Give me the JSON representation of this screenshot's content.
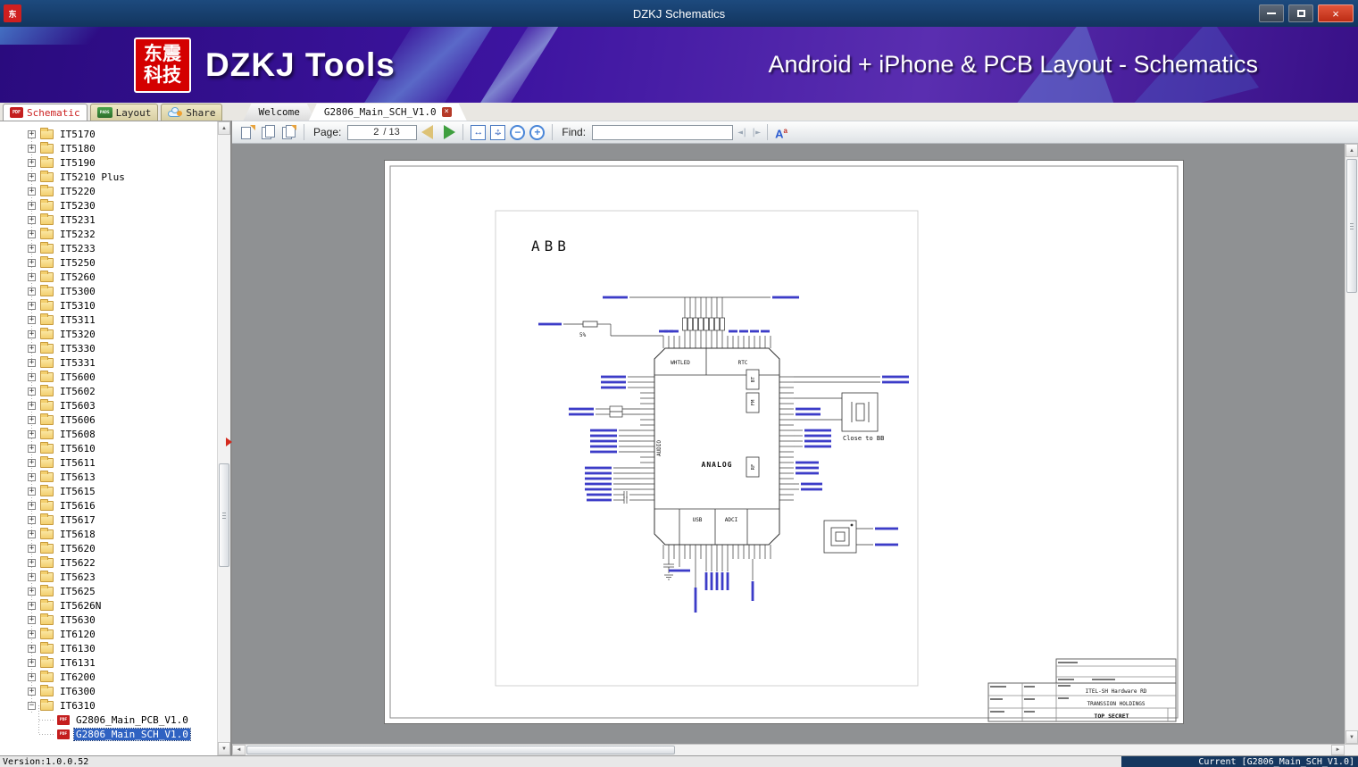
{
  "window": {
    "title": "DZKJ Schematics"
  },
  "icons": {
    "app_icon": "东",
    "pdf_badge": "PDF",
    "pads_badge": "PADS",
    "close_glyph": "×",
    "up_arrow": "▲",
    "down_arrow": "▼",
    "left_arrow": "◄",
    "right_arrow": "►",
    "find_prev": "◄|",
    "find_next": "|►",
    "fit_width": "↔",
    "fit_height": "↕",
    "zoom_out": "−",
    "zoom_in": "+",
    "font_big": "A",
    "font_small": "a",
    "expand": "+",
    "collapse": "−"
  },
  "banner": {
    "logo_line1": "东震",
    "logo_line2": "科技",
    "brand": "DZKJ Tools",
    "subtitle": "Android + iPhone & PCB Layout - Schematics"
  },
  "app_tabs": [
    {
      "label": "Schematic"
    },
    {
      "label": "Layout"
    },
    {
      "label": "Share"
    }
  ],
  "doc_tabs": [
    {
      "label": "Welcome"
    },
    {
      "label": "G2806_Main_SCH_V1.0"
    }
  ],
  "toolbar": {
    "page_label": "Page:",
    "page_value": "2",
    "page_total_label": "/ 13",
    "find_label": "Find:",
    "find_value": ""
  },
  "sidebar": {
    "folders": [
      "IT5170",
      "IT5180",
      "IT5190",
      "IT5210 Plus",
      "IT5220",
      "IT5230",
      "IT5231",
      "IT5232",
      "IT5233",
      "IT5250",
      "IT5260",
      "IT5300",
      "IT5310",
      "IT5311",
      "IT5320",
      "IT5330",
      "IT5331",
      "IT5600",
      "IT5602",
      "IT5603",
      "IT5606",
      "IT5608",
      "IT5610",
      "IT5611",
      "IT5613",
      "IT5615",
      "IT5616",
      "IT5617",
      "IT5618",
      "IT5620",
      "IT5622",
      "IT5623",
      "IT5625",
      "IT5626N",
      "IT5630",
      "IT6120",
      "IT6130",
      "IT6131",
      "IT6200",
      "IT6300"
    ],
    "expanded_folder": "IT6310",
    "children": [
      {
        "label": "G2806_Main_PCB_V1.0",
        "selected": false
      },
      {
        "label": "G2806_Main_SCH_V1.0",
        "selected": true
      }
    ]
  },
  "schematic": {
    "page_tag": "ABB",
    "chip": {
      "top_left": "WHTLED",
      "top_right": "RTC",
      "left": "AUDIO",
      "center": "ANALOG",
      "bottom_left": "USB",
      "bottom_right": "ADCI",
      "right_blocks": [
        "BT",
        "FM",
        "RF"
      ]
    },
    "note": "Close to BB",
    "resistor_tolerance": "5%",
    "title_block": {
      "department": "ITEL-SH Hardware RD",
      "company": "TRANSSION HOLDINGS",
      "classification": "TOP SECRET"
    }
  },
  "statusbar": {
    "version": "Version:1.0.0.52",
    "current": "Current [G2806_Main_SCH_V1.0]"
  }
}
